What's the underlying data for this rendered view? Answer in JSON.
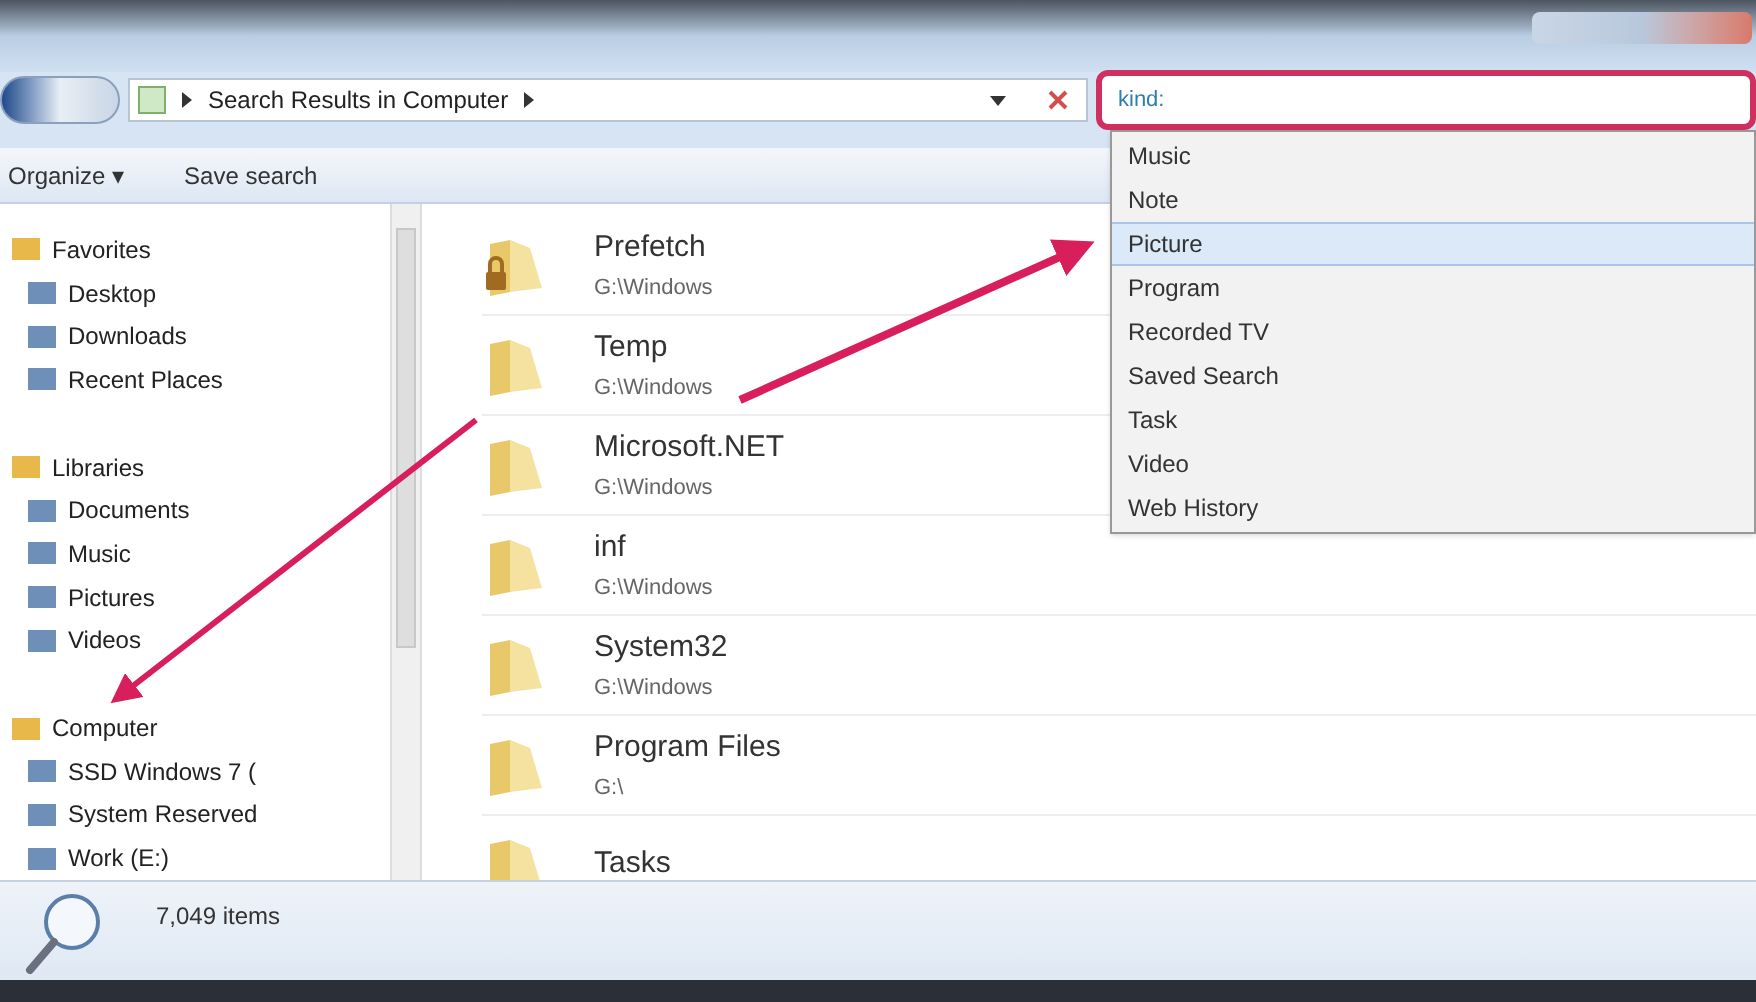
{
  "address_bar": {
    "breadcrumb": "Search Results in Computer"
  },
  "search": {
    "value": "kind:"
  },
  "toolbar": [
    "Organize ▾",
    "Save search"
  ],
  "sidebar": {
    "items": [
      {
        "label": "Favorites",
        "kind": "group"
      },
      {
        "label": "Desktop",
        "kind": "item"
      },
      {
        "label": "Downloads",
        "kind": "item"
      },
      {
        "label": "Recent Places",
        "kind": "item"
      },
      {
        "label": "Libraries",
        "kind": "group"
      },
      {
        "label": "Documents",
        "kind": "item"
      },
      {
        "label": "Music",
        "kind": "item"
      },
      {
        "label": "Pictures",
        "kind": "item"
      },
      {
        "label": "Videos",
        "kind": "item"
      },
      {
        "label": "Computer",
        "kind": "group"
      },
      {
        "label": "SSD Windows 7 (",
        "kind": "item"
      },
      {
        "label": "System Reserved",
        "kind": "item"
      },
      {
        "label": "Work (E:)",
        "kind": "item"
      }
    ]
  },
  "files": [
    {
      "name": "Prefetch",
      "path": "G:\\Windows",
      "locked": true
    },
    {
      "name": "Temp",
      "path": "G:\\Windows",
      "locked": false
    },
    {
      "name": "Microsoft.NET",
      "path": "G:\\Windows",
      "locked": false
    },
    {
      "name": "inf",
      "path": "G:\\Windows",
      "locked": false
    },
    {
      "name": "System32",
      "path": "G:\\Windows",
      "locked": false
    },
    {
      "name": "Program Files",
      "path": "G:\\",
      "locked": false
    },
    {
      "name": "Tasks",
      "locked": false
    }
  ],
  "suggestions": [
    {
      "label": "Music",
      "selected": false
    },
    {
      "label": "Note",
      "selected": false
    },
    {
      "label": "Picture",
      "selected": true
    },
    {
      "label": "Program",
      "selected": false
    },
    {
      "label": "Recorded TV",
      "selected": false
    },
    {
      "label": "Saved Search",
      "selected": false
    },
    {
      "label": "Task",
      "selected": false
    },
    {
      "label": "Video",
      "selected": false
    },
    {
      "label": "Web History",
      "selected": false
    }
  ],
  "status_bar": {
    "count": "7,049 items"
  }
}
